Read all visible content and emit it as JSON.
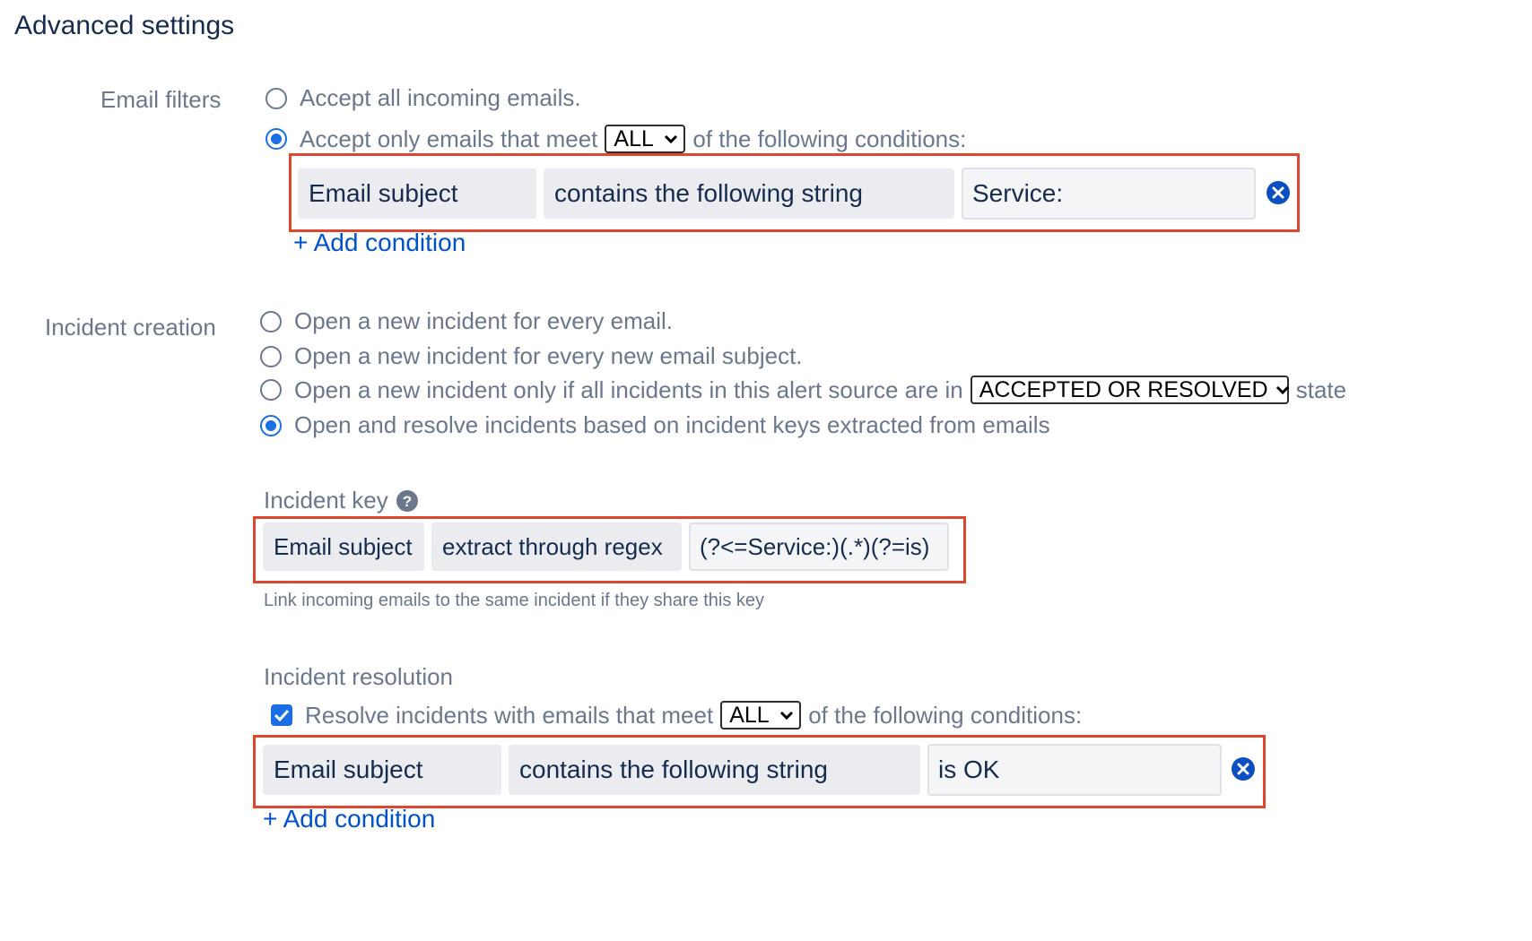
{
  "title": "Advanced settings",
  "email_filters": {
    "label": "Email filters",
    "option_all": "Accept all incoming emails.",
    "option_only_prefix": "Accept only emails that meet",
    "option_only_suffix": "of the following conditions:",
    "match_select": "ALL",
    "condition": {
      "field": "Email subject",
      "operator": "contains the following string",
      "value": "Service:"
    },
    "add_condition": "+ Add condition"
  },
  "incident_creation": {
    "label": "Incident creation",
    "option_every_email": "Open a new incident for every email.",
    "option_every_subject": "Open a new incident for every new email subject.",
    "option_state_prefix": "Open a new incident only if all incidents in this alert source are in",
    "state_select": "ACCEPTED OR RESOLVED",
    "option_state_suffix": "state",
    "option_keys": "Open and resolve incidents based on incident keys extracted from emails"
  },
  "incident_key": {
    "label": "Incident key",
    "field": "Email subject",
    "operator": "extract through regex",
    "value": "(?<=Service:)(.*)(?=is)",
    "helper": "Link incoming emails to the same incident if they share this key"
  },
  "incident_resolution": {
    "label": "Incident resolution",
    "checkbox_prefix": "Resolve incidents with emails that meet",
    "match_select": "ALL",
    "checkbox_suffix": "of the following conditions:",
    "condition": {
      "field": "Email subject",
      "operator": "contains the following string",
      "value": "is OK"
    },
    "add_condition": "+ Add condition"
  },
  "colors": {
    "accent": "#1a6fe5",
    "link": "#0052cc",
    "highlight_border": "#e0452f",
    "muted_text": "#6b778c",
    "dark_text": "#172b4d"
  },
  "icons": [
    "radio-icon",
    "chevron-down-icon",
    "remove-circle-icon",
    "help-icon",
    "checkmark-icon"
  ]
}
